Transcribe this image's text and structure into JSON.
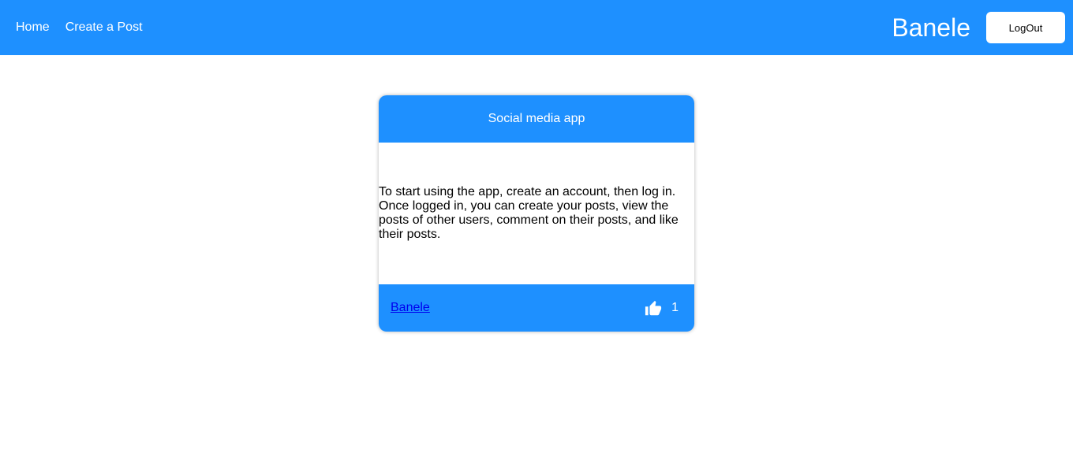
{
  "navbar": {
    "links": [
      {
        "label": "Home"
      },
      {
        "label": "Create a Post"
      }
    ],
    "username": "Banele",
    "logout_label": "LogOut"
  },
  "post": {
    "title": "Social media app",
    "body": "To start using the app, create an account, then log in. Once logged in, you can create your posts, view the posts of other users, comment on their posts, and like their posts.",
    "author": "Banele",
    "likes": "1",
    "like_icon": "thumbs-up-icon"
  },
  "colors": {
    "primary": "#1e90ff",
    "text_on_primary": "#ffffff",
    "link": "#0000ee"
  }
}
